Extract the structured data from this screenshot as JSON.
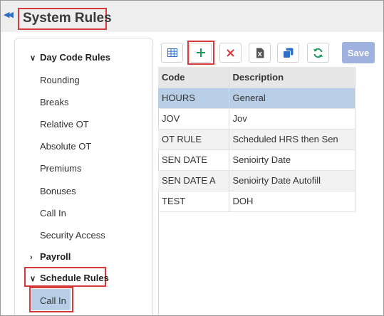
{
  "header": {
    "title": "System Rules"
  },
  "sidebar": {
    "groups": [
      {
        "label": "Day Code Rules",
        "expanded": true,
        "items": [
          "Rounding",
          "Breaks",
          "Relative OT",
          "Absolute OT",
          "Premiums",
          "Bonuses",
          "Call In",
          "Security Access"
        ]
      },
      {
        "label": "Payroll",
        "expanded": false,
        "items": []
      },
      {
        "label": "Schedule Rules",
        "expanded": true,
        "items": [
          "Call In"
        ]
      }
    ],
    "selected": "Call In"
  },
  "toolbar": {
    "buttons": [
      {
        "icon": "grid-icon",
        "color": "#2f6fc4"
      },
      {
        "icon": "plus-icon",
        "color": "#1a9a5a"
      },
      {
        "icon": "close-icon",
        "color": "#d63a3a"
      },
      {
        "icon": "excel-icon",
        "color": "#555555"
      },
      {
        "icon": "copy-icon",
        "color": "#2f6fc4"
      },
      {
        "icon": "refresh-icon",
        "color": "#1a9a5a"
      }
    ],
    "save_label": "Save"
  },
  "grid": {
    "columns": [
      "Code",
      "Description"
    ],
    "rows": [
      {
        "code": "HOURS",
        "description": "General",
        "selected": true
      },
      {
        "code": "JOV",
        "description": "Jov",
        "selected": false
      },
      {
        "code": "OT RULE",
        "description": "Scheduled HRS then Sen",
        "selected": false
      },
      {
        "code": "SEN DATE",
        "description": "Senioirty Date",
        "selected": false
      },
      {
        "code": "SEN DATE A",
        "description": "Senioirty Date Autofill",
        "selected": false
      },
      {
        "code": "TEST",
        "description": "DOH",
        "selected": false
      }
    ]
  },
  "colors": {
    "highlight": "#d63a3a",
    "selected_row": "#b8cde6",
    "save_button": "#9fb1df"
  }
}
